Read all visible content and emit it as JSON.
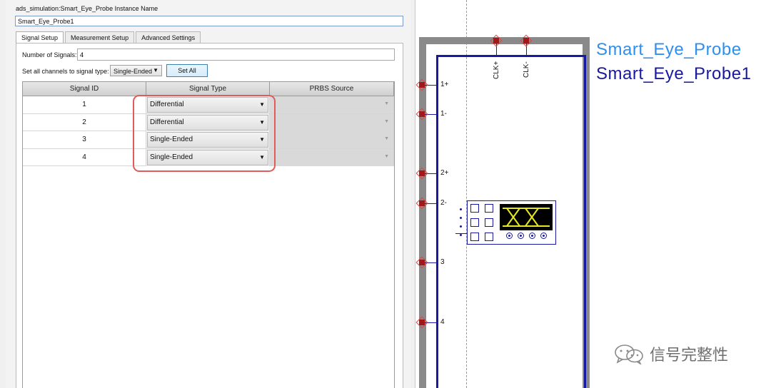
{
  "dialog": {
    "instance_label": "ads_simulation:Smart_Eye_Probe Instance Name",
    "instance_value": "Smart_Eye_Probe1",
    "tabs": [
      {
        "label": "Signal Setup",
        "active": true
      },
      {
        "label": "Measurement Setup",
        "active": false
      },
      {
        "label": "Advanced Settings",
        "active": false
      }
    ],
    "num_signals_label": "Number of Signals:",
    "num_signals_value": "4",
    "set_all_label": "Set all channels to signal type:",
    "set_all_type": "Single-Ended",
    "set_all_button": "Set All",
    "table": {
      "headers": [
        "Signal ID",
        "Signal Type",
        "PRBS Source"
      ],
      "rows": [
        {
          "id": "1",
          "type": "Differential",
          "prbs": ""
        },
        {
          "id": "2",
          "type": "Differential",
          "prbs": ""
        },
        {
          "id": "3",
          "type": "Single-Ended",
          "prbs": ""
        },
        {
          "id": "4",
          "type": "Single-Ended",
          "prbs": ""
        }
      ]
    },
    "highlight_color": "#e25a5a"
  },
  "schematic": {
    "component_name": "Smart_Eye_Probe",
    "instance_name": "Smart_Eye_Probe1",
    "clock_pins": [
      "CLK+",
      "CLK-"
    ],
    "signal_pins": [
      "1+",
      "1-",
      "2+",
      "2-",
      "3",
      "4"
    ],
    "colors": {
      "component_name": "#2d8ff0",
      "instance_name": "#1818a0",
      "pin": "#a01818",
      "frame": "#8a8a8a"
    }
  },
  "watermark": {
    "text": "信号完整性",
    "icon": "wechat-icon"
  }
}
